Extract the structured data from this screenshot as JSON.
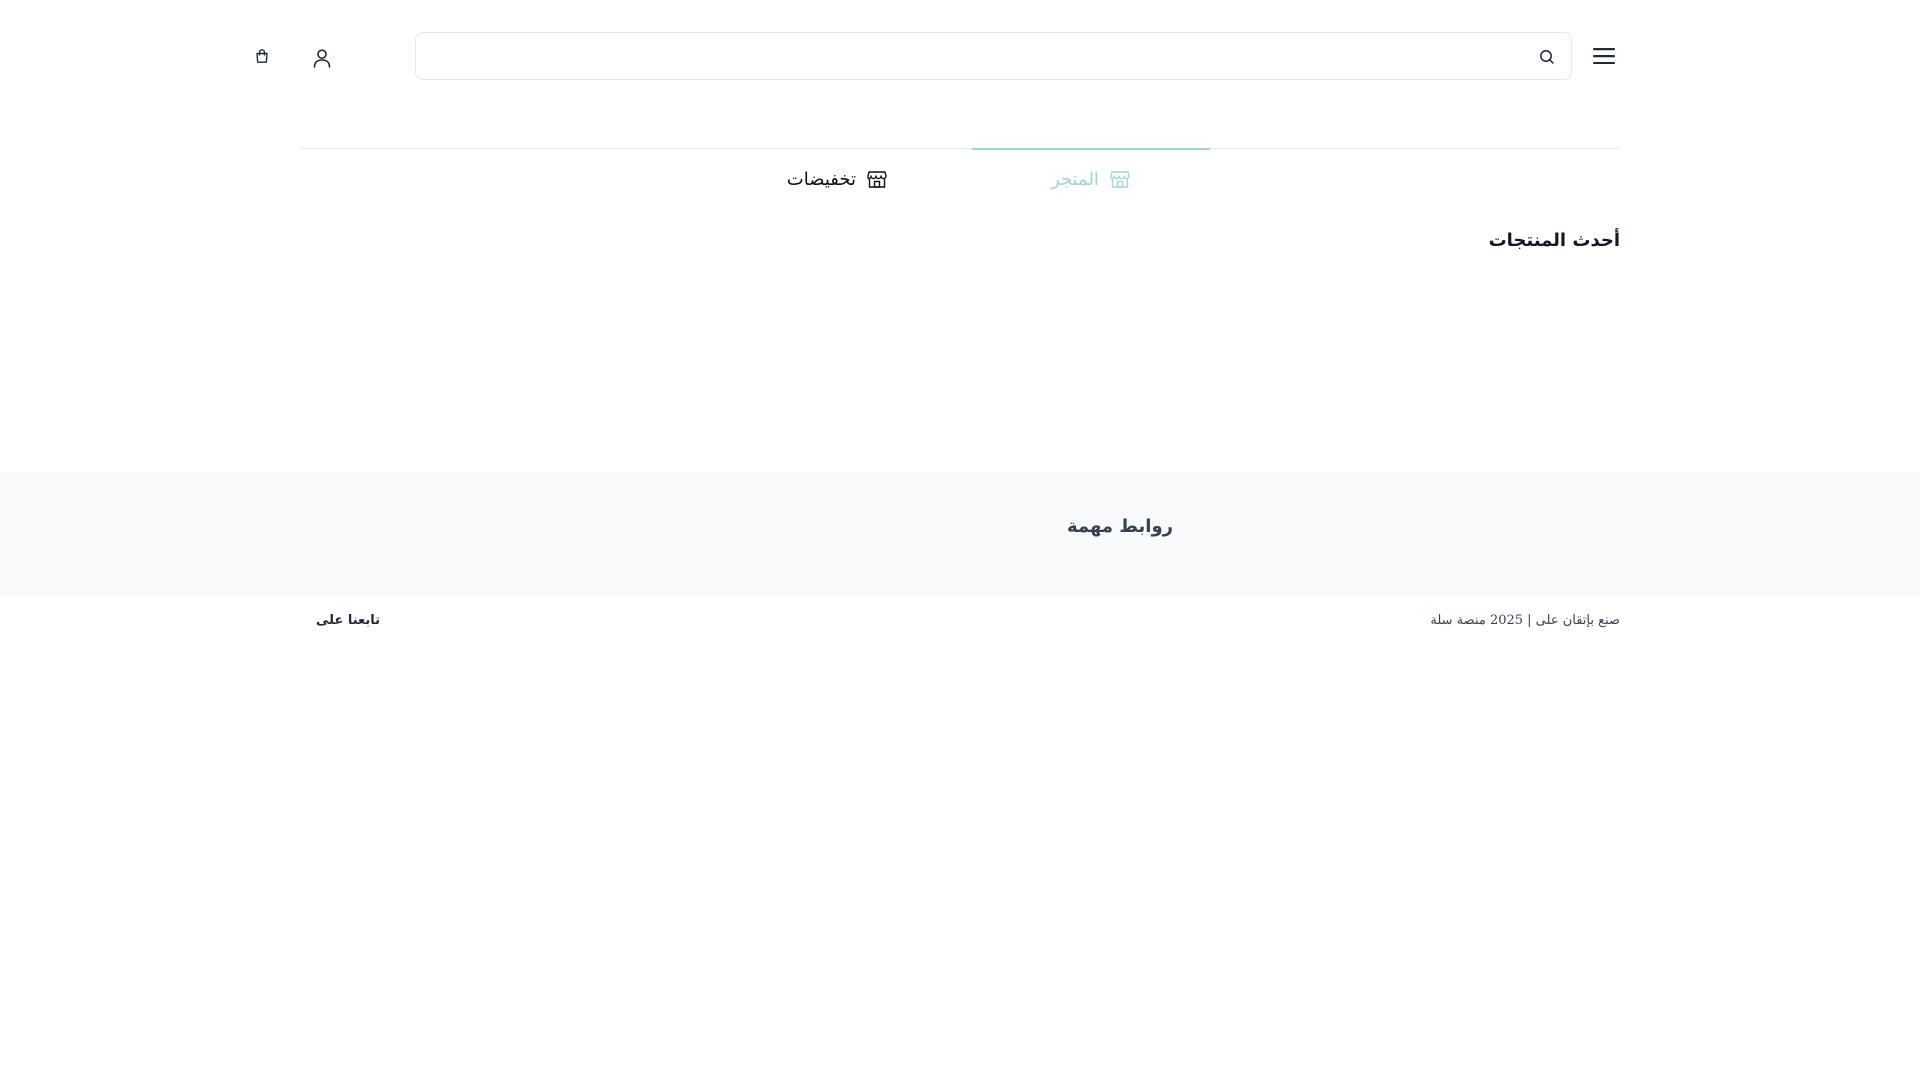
{
  "header": {
    "search_placeholder": "",
    "menu_icon": "hamburger-menu-icon",
    "search_icon": "search-icon",
    "user_icon": "user-icon",
    "cart_icon": "shopping-bag-icon"
  },
  "nav": {
    "tabs": [
      {
        "label": "المتجر",
        "icon": "store-icon",
        "active": true
      },
      {
        "label": "تخفيضات",
        "icon": "store-icon",
        "active": false
      }
    ]
  },
  "main": {
    "latest_products_title": "أحدث المنتجات"
  },
  "footer": {
    "links_title": "روابط مهمة",
    "copyright": "صنع بإتقان على | 2025 منصة سلة",
    "follow_us": "تابعنا على"
  },
  "colors": {
    "accent": "#9fd6d8",
    "footer_bg": "#f8f9fb",
    "border": "#e5e7eb",
    "text": "#111827"
  }
}
